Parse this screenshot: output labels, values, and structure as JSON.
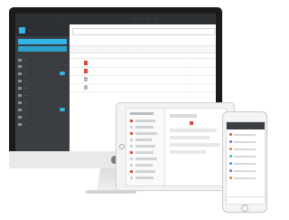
{
  "colors": {
    "accent": "#32b5e5",
    "file_red": "#d94a3d",
    "sidebar_bg": "#3a3e42"
  },
  "monitor": {
    "topbar": {
      "brand": "...",
      "nav": [
        "...",
        "...",
        "...",
        "..."
      ]
    },
    "sidebar": {
      "title": "...",
      "buttons": [
        "..."
      ],
      "items": [
        "...",
        "...",
        "...",
        "...",
        "...",
        "...",
        "...",
        "...",
        "...",
        "..."
      ]
    },
    "main": {
      "breadcrumb": "...",
      "toolbar": [
        "...",
        "...",
        "...",
        "..."
      ],
      "columns": [
        "...",
        "...",
        "..."
      ],
      "rows": [
        {
          "name": "...",
          "meta": "..."
        },
        {
          "name": "...",
          "meta": "..."
        },
        {
          "name": "...",
          "meta": "..."
        },
        {
          "name": "...",
          "meta": "..."
        }
      ]
    }
  },
  "tablet": {
    "list_item_colors": [
      "#d94a3d",
      "#cfd3d6",
      "#d94a3d",
      "#cfd3d6",
      "#cfd3d6",
      "#d94a3d",
      "#cfd3d6",
      "#cfd3d6",
      "#d94a3d",
      "#cfd3d6"
    ]
  },
  "phone": {
    "list_item_colors": [
      "#d94a3d",
      "#9b59b6",
      "#e67e22",
      "#2ecc71",
      "#3498db",
      "#9b59b6",
      "#e67e22"
    ]
  }
}
